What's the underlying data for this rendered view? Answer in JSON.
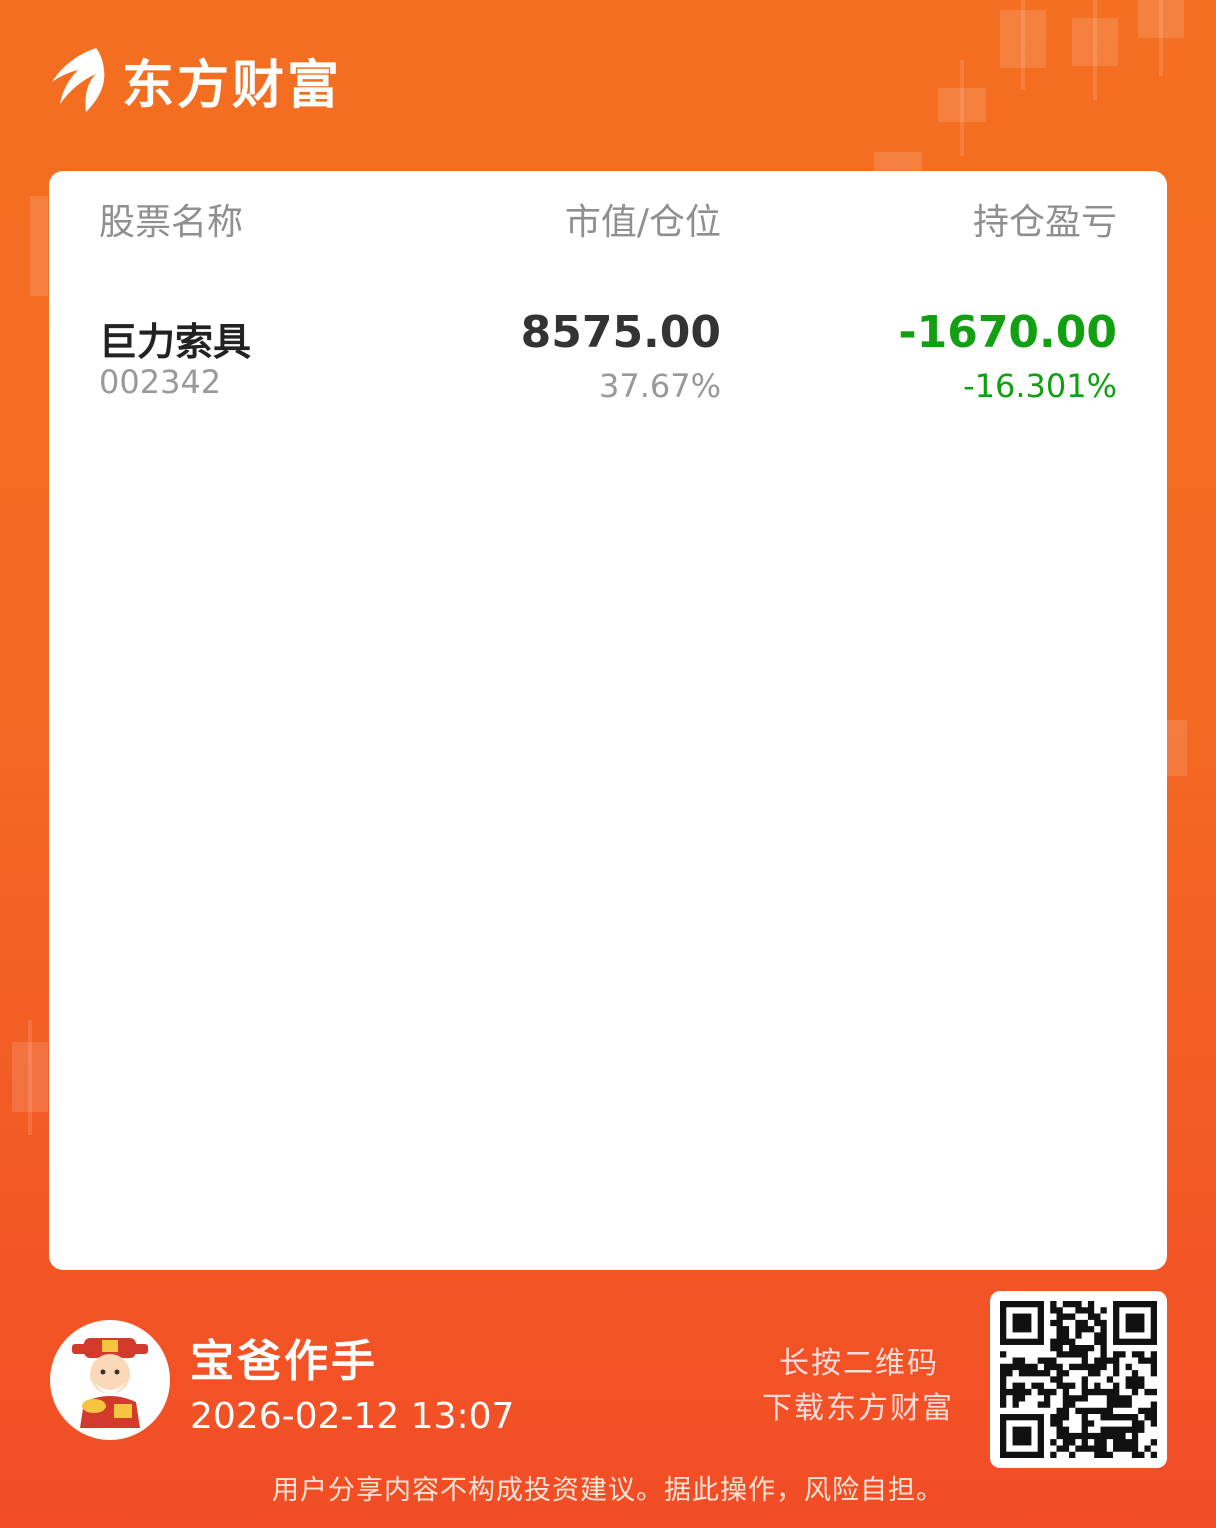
{
  "brand": {
    "name": "东方财富",
    "logo_icon": "eastmoney-swoosh-icon"
  },
  "table": {
    "headers": {
      "name": "股票名称",
      "value": "市值/仓位",
      "pl": "持仓盈亏"
    },
    "rows": [
      {
        "name": "巨力索具",
        "code": "002342",
        "market_value": "8575.00",
        "position": "37.67%",
        "pl_amount": "-1670.00",
        "pl_percent": "-16.301%"
      }
    ]
  },
  "user": {
    "name": "宝爸作手",
    "datetime": "2026-02-12 13:07",
    "avatar_icon": "caishen-avatar-icon"
  },
  "download": {
    "line1": "长按二维码",
    "line2": "下载东方财富",
    "qr_icon": "qr-code-icon"
  },
  "disclaimer": "用户分享内容不构成投资建议。据此操作，风险自担。",
  "colors": {
    "background_top": "#f46f22",
    "background_bottom": "#f24d26",
    "loss_green": "#12a012",
    "card": "#ffffff"
  }
}
